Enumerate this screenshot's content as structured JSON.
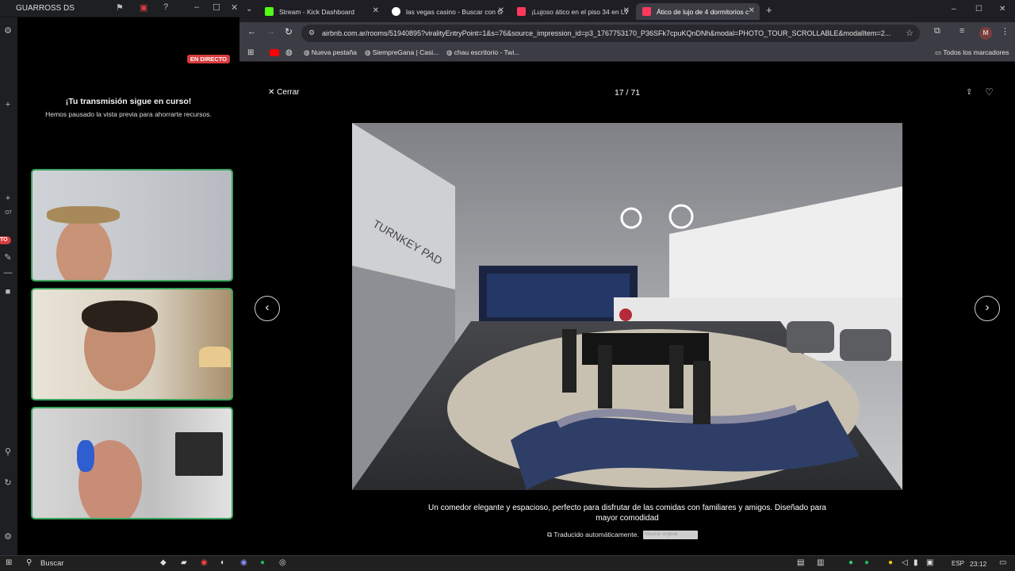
{
  "discord": {
    "app_title": "GUARROSS DS",
    "live_badge": "EN DIRECTO",
    "stream_title": "¡Tu transmisión sigue en curso!",
    "stream_subtitle": "Hemos pausado la vista previa para ahorrarte recursos.",
    "side_timer": ":07",
    "side_live_short": "TO"
  },
  "browser": {
    "tabs": [
      {
        "label": "Stream - Kick Dashboard",
        "favicon_color": "#53fc18"
      },
      {
        "label": "las vegas casino - Buscar con G",
        "favicon_color": "#ffffff"
      },
      {
        "label": "¡Lujoso ático en el piso 34 en LV",
        "favicon_color": "#ff385c"
      },
      {
        "label": "Ático de lujo de 4 dormitorios c",
        "favicon_color": "#ff385c"
      }
    ],
    "url": "airbnb.com.ar/rooms/51940895?viralityEntryPoint=1&s=76&source_impression_id=p3_1767753170_P36SFk7cpuKQnDNh&modal=PHOTO_TOUR_SCROLLABLE&modalItem=2...",
    "profile_initial": "M",
    "bookmarks": [
      "Nueva pestaña",
      "SiempreGana | Casi...",
      "chau escritorio - Twi..."
    ],
    "all_bookmarks": "Todos los marcadores"
  },
  "photo_tour": {
    "close_label": "Cerrar",
    "counter": "17 / 71",
    "caption": "Un comedor elegante y espacioso, perfecto para disfrutar de las comidas con familiares y amigos. Diseñado para mayor comodidad",
    "translated_note": "Traducido automáticamente.",
    "show_original": "Mostrar original",
    "wall_brand": "TURNKEY PAD"
  },
  "taskbar": {
    "search_placeholder": "Buscar",
    "language": "ESP",
    "time": "23:12"
  },
  "colors": {
    "live_red": "#d83c3e",
    "tile_border": "#3ba55d",
    "chrome_dark": "#1e1e24",
    "chrome_toolbar": "#3c3c44"
  }
}
